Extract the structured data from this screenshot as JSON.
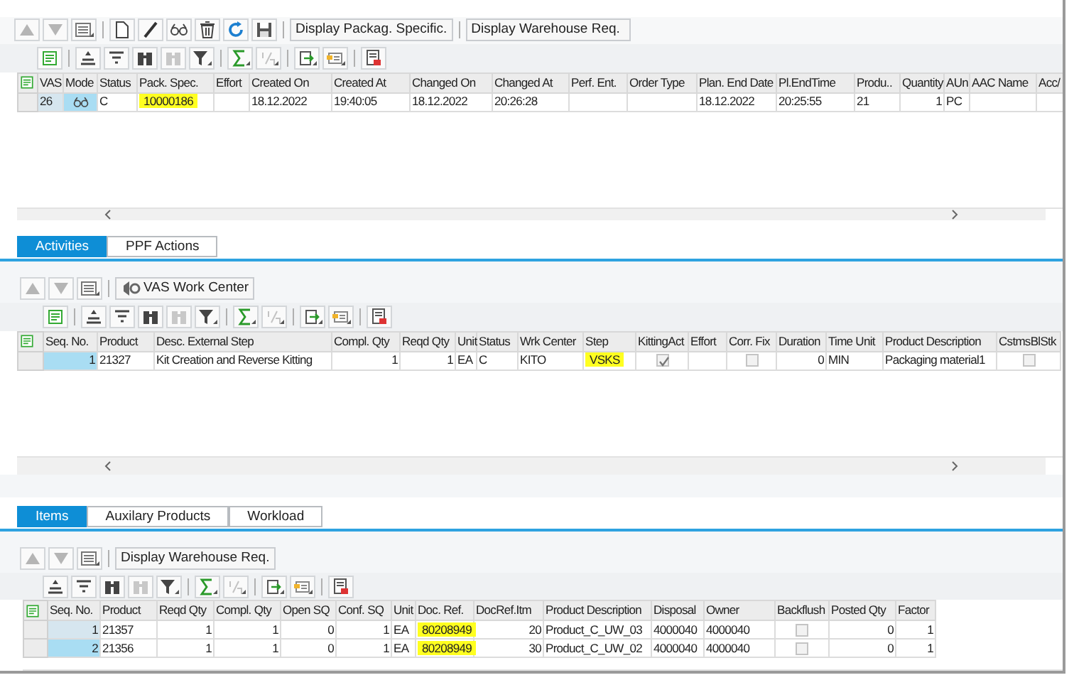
{
  "order_panel": {
    "toolbar_buttons": [
      "Display Packag. Specific.",
      "Display Warehouse Req."
    ],
    "grid": {
      "columns": [
        "VAS",
        "Mode",
        "Status",
        "Pack. Spec.",
        "Effort",
        "Created On",
        "Created At",
        "Changed On",
        "Changed At",
        "Perf. Ent.",
        "Order Type",
        "Plan. End Date",
        "Pl.EndTime",
        "Produ..",
        "Quantity",
        "AUn",
        "AAC Name",
        "Acc/"
      ],
      "rows": [
        {
          "selected": false,
          "cells": [
            "26",
            {
              "kind": "icon"
            },
            "C",
            {
              "text": "10000186",
              "highlighted": true
            },
            null,
            "18.12.2022",
            "19:40:05",
            "18.12.2022",
            "20:26:28",
            null,
            null,
            "18.12.2022",
            "20:25:55",
            "21",
            "1",
            "PC",
            null,
            null
          ]
        }
      ]
    }
  },
  "activities_panel": {
    "tabs": [
      {
        "label": "Activities",
        "selected": true
      },
      {
        "label": "PPF Actions",
        "selected": false
      }
    ],
    "toolbar_buttons": [
      "VAS Work Center"
    ],
    "grid": {
      "columns": [
        "Seq. No.",
        "Product",
        "Desc. External Step",
        "Compl. Qty",
        "Reqd Qty",
        "Unit",
        "Status",
        "Wrk Center",
        "Step",
        "KittingAct",
        "Effort",
        "Corr. Fix",
        "Duration",
        "Time Unit",
        "Product Description",
        "CstmsBlStk"
      ],
      "rows": [
        {
          "selected": true,
          "cells": [
            "1",
            "21327",
            "Kit Creation and Reverse Kitting",
            "1",
            "1",
            "EA",
            "C",
            "KITO",
            {
              "text": "VSKS",
              "highlighted": true
            },
            {
              "kind": "checkbox",
              "checked": true
            },
            null,
            {
              "kind": "checkbox",
              "checked": false
            },
            "0",
            "MIN",
            "Packaging material1",
            {
              "kind": "checkbox",
              "checked": false
            }
          ]
        }
      ]
    }
  },
  "items_panel": {
    "tabs": [
      {
        "label": "Items",
        "selected": true
      },
      {
        "label": "Auxilary Products",
        "selected": false
      },
      {
        "label": "Workload",
        "selected": false
      }
    ],
    "toolbar_buttons": [
      "Display Warehouse Req."
    ],
    "grid": {
      "columns": [
        "Seq. No.",
        "Product",
        "Reqd Qty",
        "Compl. Qty",
        "Open SQ",
        "Conf. SQ",
        "Unit",
        "Doc. Ref.",
        "DocRef.Itm",
        "Product Description",
        "Disposal",
        "Owner",
        "Backflush",
        "Posted Qty",
        "Factor"
      ],
      "rows": [
        {
          "selected": false,
          "cells": [
            "1",
            "21357",
            "1",
            "1",
            "0",
            "1",
            "EA",
            {
              "text": "80208949",
              "highlighted": true
            },
            "20",
            "Product_C_UW_03",
            "4000040",
            "4000040",
            {
              "kind": "checkbox",
              "checked": false
            },
            "0",
            "1"
          ]
        },
        {
          "selected": true,
          "cells": [
            "2",
            "21356",
            "1",
            "1",
            "0",
            "1",
            "EA",
            {
              "text": "80208949",
              "highlighted": true
            },
            "30",
            "Product_C_UW_02",
            "4000040",
            "4000040",
            {
              "kind": "checkbox",
              "checked": false
            },
            "0",
            "1"
          ]
        }
      ]
    }
  }
}
